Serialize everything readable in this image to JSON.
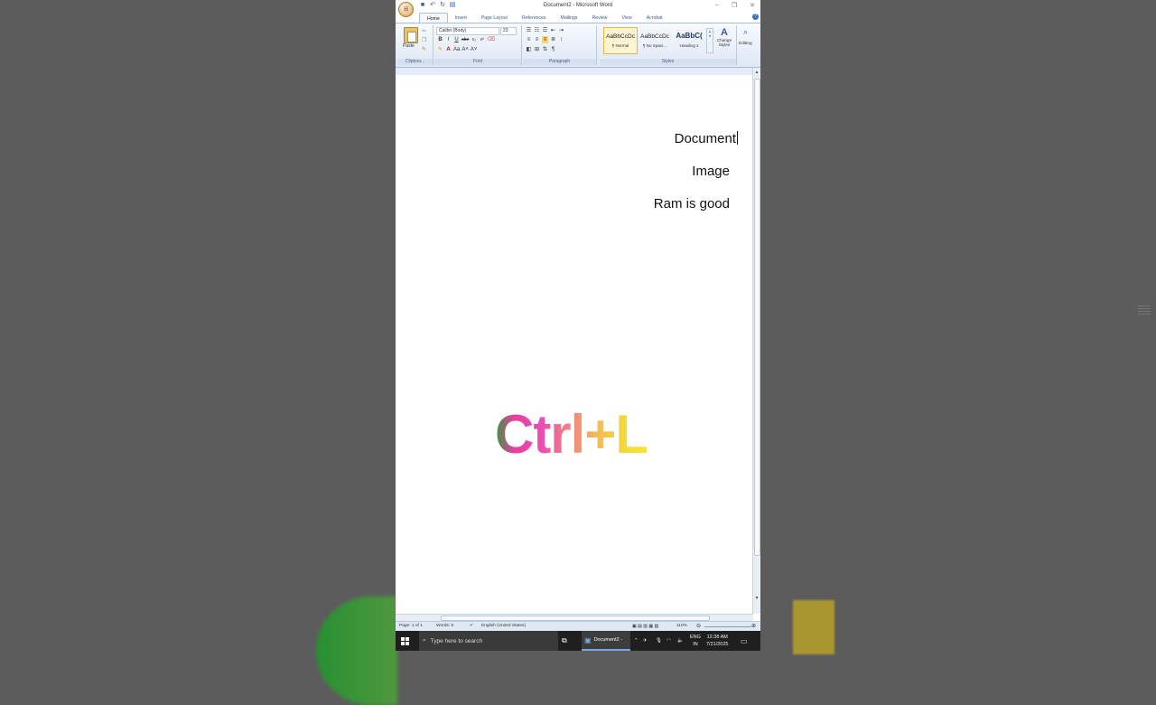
{
  "window": {
    "title": "Document2 - Microsoft Word",
    "controls": [
      "–",
      "❐",
      "✕"
    ]
  },
  "qat": {
    "icons": [
      "save-icon",
      "undo-icon",
      "redo-icon",
      "print-preview-icon"
    ]
  },
  "tabs": [
    "Home",
    "Insert",
    "Page Layout",
    "References",
    "Mailings",
    "Review",
    "View",
    "Acrobat"
  ],
  "ribbon": {
    "clipboard": {
      "paste_label": "Paste",
      "group_label": "Clipboa..."
    },
    "font": {
      "family": "Calibri (Body)",
      "size": "23",
      "group_label": "Font",
      "format_buttons": [
        "B",
        "I",
        "U",
        "abe",
        "x₂",
        "x²"
      ]
    },
    "paragraph": {
      "group_label": "Paragraph"
    },
    "styles": {
      "group_label": "Styles",
      "items": [
        {
          "sample": "AaBbCcDc",
          "name": "¶ Normal"
        },
        {
          "sample": "AaBbCcDc",
          "name": "¶ No Spaci..."
        },
        {
          "sample": "AaBbC(",
          "name": "Heading 1"
        }
      ],
      "change_styles": "Change Styles"
    },
    "editing": {
      "label": "Editing"
    }
  },
  "document": {
    "lines": [
      "Document",
      "Image",
      "Ram is good"
    ]
  },
  "overlay": {
    "text": "Ctrl+L"
  },
  "statusbar": {
    "page": "Page: 1 of 1",
    "words": "Words: 5",
    "language": "English (United States)",
    "zoom": "110%"
  },
  "taskbar": {
    "search_placeholder": "Type here to search",
    "word_task": "Document2 -",
    "lang1": "ENG",
    "lang2": "IN",
    "time": "12:38 AM",
    "date": "7/21/2025"
  }
}
